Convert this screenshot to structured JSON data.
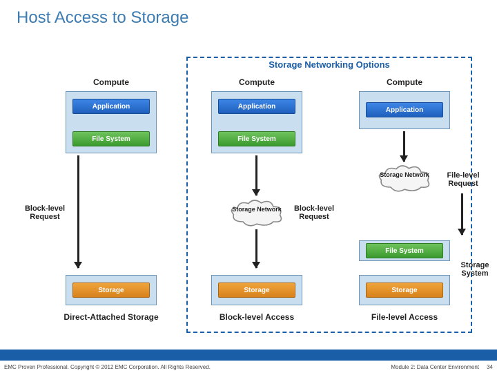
{
  "title": "Host Access to Storage",
  "dashed_box_title": "Storage Networking Options",
  "columns": {
    "c1": "Compute",
    "c2": "Compute",
    "c3": "Compute"
  },
  "bars": {
    "application": "Application",
    "file_system": "File System",
    "storage": "Storage"
  },
  "clouds": {
    "storage_network": "Storage Network"
  },
  "labels": {
    "block_request": "Block-level Request",
    "file_request": "File-level Request",
    "storage_system": "Storage System"
  },
  "captions": {
    "direct_attached": "Direct-Attached Storage",
    "block_access": "Block-level Access",
    "file_access": "File-level Access"
  },
  "footer": {
    "left": "EMC Proven Professional. Copyright © 2012 EMC Corporation. All Rights Reserved.",
    "right": "Module 2: Data Center Environment",
    "page": "34"
  }
}
